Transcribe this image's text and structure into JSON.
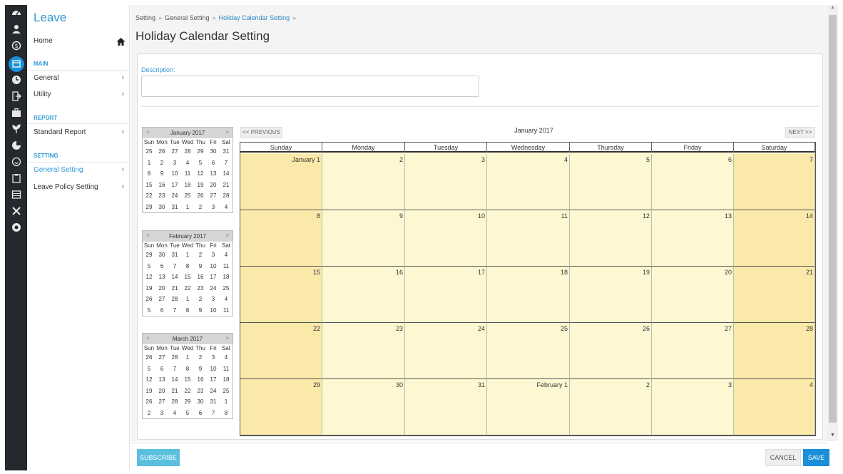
{
  "rail": {
    "icons": [
      "dashboard-icon",
      "user-icon",
      "payroll-icon",
      "calendar-icon",
      "clock-icon",
      "logout-icon",
      "briefcase-icon",
      "plant-icon",
      "pie-chart-icon",
      "smile-icon",
      "clipboard-icon",
      "table-icon",
      "tools-icon",
      "power-icon"
    ],
    "active": "calendar-icon"
  },
  "sidebar": {
    "app_title": "Leave",
    "home_label": "Home",
    "sections": [
      {
        "heading": "MAIN",
        "items": [
          {
            "label": "General"
          },
          {
            "label": "Utility"
          }
        ]
      },
      {
        "heading": "REPORT",
        "items": [
          {
            "label": "Standard Report"
          }
        ]
      },
      {
        "heading": "SETTING",
        "items": [
          {
            "label": "General Setting",
            "active": true
          },
          {
            "label": "Leave Policy Setting"
          }
        ]
      }
    ]
  },
  "breadcrumb": [
    "Setting",
    "General Setting",
    "Holiday Calendar Setting"
  ],
  "page_title": "Holiday Calendar Setting",
  "form": {
    "description_label": "Description:",
    "description_value": ""
  },
  "mini_calendars": [
    {
      "title": "January 2017",
      "weekdays": [
        "Sun",
        "Mon",
        "Tue",
        "Wed",
        "Thu",
        "Fri",
        "Sat"
      ],
      "weeks": [
        [
          "25",
          "26",
          "27",
          "28",
          "29",
          "30",
          "31"
        ],
        [
          "1",
          "2",
          "3",
          "4",
          "5",
          "6",
          "7"
        ],
        [
          "8",
          "9",
          "10",
          "11",
          "12",
          "13",
          "14"
        ],
        [
          "15",
          "16",
          "17",
          "18",
          "19",
          "20",
          "21"
        ],
        [
          "22",
          "23",
          "24",
          "25",
          "26",
          "27",
          "28"
        ],
        [
          "29",
          "30",
          "31",
          "1",
          "2",
          "3",
          "4"
        ]
      ]
    },
    {
      "title": "February 2017",
      "weekdays": [
        "Sun",
        "Mon",
        "Tue",
        "Wed",
        "Thu",
        "Fri",
        "Sat"
      ],
      "weeks": [
        [
          "29",
          "30",
          "31",
          "1",
          "2",
          "3",
          "4"
        ],
        [
          "5",
          "6",
          "7",
          "8",
          "9",
          "10",
          "11"
        ],
        [
          "12",
          "13",
          "14",
          "15",
          "16",
          "17",
          "18"
        ],
        [
          "19",
          "20",
          "21",
          "22",
          "23",
          "24",
          "25"
        ],
        [
          "26",
          "27",
          "28",
          "1",
          "2",
          "3",
          "4"
        ],
        [
          "5",
          "6",
          "7",
          "8",
          "9",
          "10",
          "11"
        ]
      ]
    },
    {
      "title": "March 2017",
      "weekdays": [
        "Sun",
        "Mon",
        "Tue",
        "Wed",
        "Thu",
        "Fri",
        "Sat"
      ],
      "weeks": [
        [
          "26",
          "27",
          "28",
          "1",
          "2",
          "3",
          "4"
        ],
        [
          "5",
          "6",
          "7",
          "8",
          "9",
          "10",
          "11"
        ],
        [
          "12",
          "13",
          "14",
          "15",
          "16",
          "17",
          "18"
        ],
        [
          "19",
          "20",
          "21",
          "22",
          "23",
          "24",
          "25"
        ],
        [
          "26",
          "27",
          "28",
          "29",
          "30",
          "31",
          "1"
        ],
        [
          "2",
          "3",
          "4",
          "5",
          "6",
          "7",
          "8"
        ]
      ]
    }
  ],
  "mini_prev": "<",
  "mini_next": ">",
  "calendar": {
    "prev_label": "<< PREVIOUS",
    "next_label": "NEXT >>",
    "month_title": "January 2017",
    "weekdays": [
      "Sunday",
      "Monday",
      "Tuesday",
      "Wednesday",
      "Thursday",
      "Friday",
      "Saturday"
    ],
    "weeks": [
      [
        "January 1",
        "2",
        "3",
        "4",
        "5",
        "6",
        "7"
      ],
      [
        "8",
        "9",
        "10",
        "11",
        "12",
        "13",
        "14"
      ],
      [
        "15",
        "16",
        "17",
        "18",
        "19",
        "20",
        "21"
      ],
      [
        "22",
        "23",
        "24",
        "25",
        "26",
        "27",
        "28"
      ],
      [
        "29",
        "30",
        "31",
        "February 1",
        "2",
        "3",
        "4"
      ]
    ]
  },
  "footer": {
    "subscribe_label": "SUBSCRIBE",
    "cancel_label": "CANCEL",
    "save_label": "SAVE"
  },
  "colors": {
    "accent": "#3399d6",
    "primary_button": "#1a8fd8",
    "subscribe_button": "#5bc0de",
    "weekday_cell": "#fef8d2",
    "weekend_cell": "#fbe9a9",
    "rail_bg": "#25292e"
  }
}
